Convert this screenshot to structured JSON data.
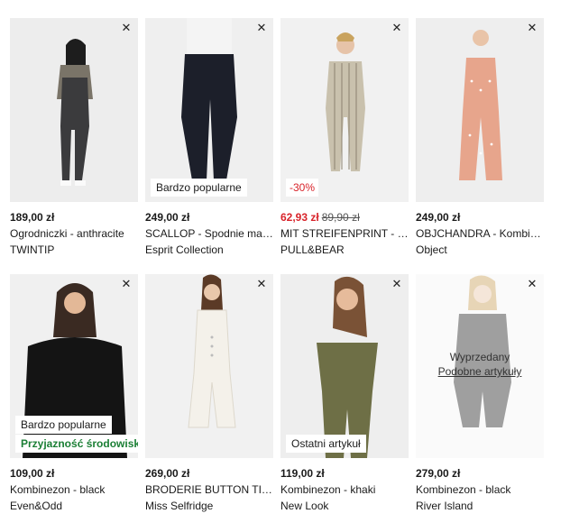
{
  "close_glyph": "✕",
  "products": [
    {
      "price": "189,00 zł",
      "name": "Ogrodniczki - anthracite",
      "brand": "TWINTIP",
      "bg": "#ededed",
      "outfit": "#3b3b3d",
      "top": "#7a7468"
    },
    {
      "price": "249,00 zł",
      "name": "SCALLOP - Spodnie materiałowe",
      "brand": "Esprit Collection",
      "flag": "Bardzo popularne",
      "bg": "#efefef",
      "outfit": "#1c1f2a",
      "top": "#f4f4f4"
    },
    {
      "price_sale": "62,93 zł",
      "price_old": "89,90 zł",
      "name": "MIT STREIFENPRINT - Kombinezon",
      "brand": "PULL&BEAR",
      "sale_flag": "-30%",
      "bg": "#f1f1f1",
      "outfit": "#c9c1ad",
      "top": "#d3cbb8"
    },
    {
      "price": "249,00 zł",
      "name": "OBJCHANDRA - Kombinezon",
      "brand": "Object",
      "bg": "#eeeeee",
      "outfit": "#e7a58c",
      "top": "#e7a58c"
    },
    {
      "price": "109,00 zł",
      "name": "Kombinezon - black",
      "brand": "Even&Odd",
      "flag": "Bardzo popularne",
      "eco": "Przyjazność środowisku",
      "bg": "#f0f0f0",
      "outfit": "#141414",
      "top": "#141414"
    },
    {
      "price": "269,00 zł",
      "name": "BRODERIE BUTTON TIE - Kombinezon",
      "brand": "Miss Selfridge",
      "bg": "#f1f1f1",
      "outfit": "#f4f1ea",
      "top": "#f4f1ea"
    },
    {
      "price": "119,00 zł",
      "name": "Kombinezon - khaki",
      "brand": "New Look",
      "flag": "Ostatni artykuł",
      "bg": "#eeeeee",
      "outfit": "#6e6f46",
      "top": "#6e6f46"
    },
    {
      "price": "279,00 zł",
      "name": "Kombinezon - black",
      "brand": "River Island",
      "soldout_title": "Wyprzedany",
      "soldout_link": "Podobne artykuły",
      "bg": "#f3f3f3",
      "outfit": "#2a2a2a",
      "top": "#2a2a2a"
    }
  ]
}
